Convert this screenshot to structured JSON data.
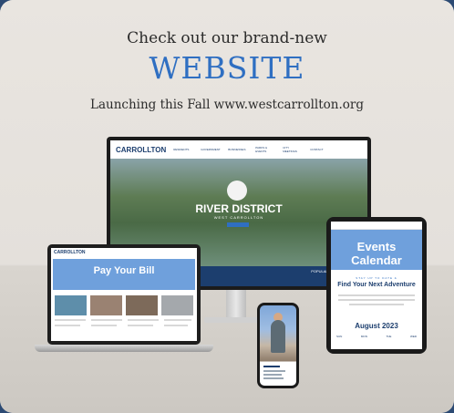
{
  "headline": "Check out our brand-new",
  "website_word": "WEBSITE",
  "launch_line": "Launching this Fall www.westcarrollton.org",
  "monitor": {
    "logo": "CARROLLTON",
    "nav_items": [
      "RESIDENTS",
      "GOVERNMENT",
      "BUSINESSES",
      "PARKS & EVENTS",
      "CITY MEETINGS",
      "CONTACT"
    ],
    "hero_title": "RIVER DISTRICT",
    "hero_subtitle": "WEST CARROLLTON",
    "footer_label": "POPULAR LINKS"
  },
  "laptop": {
    "logo": "CARROLLTON",
    "banner_title": "Pay Your Bill"
  },
  "tablet": {
    "banner_title": "Events Calendar",
    "kicker": "STAY UP TO DATE &",
    "find": "Find Your Next Adventure",
    "month": "August 2023",
    "days": [
      "SUN",
      "MON",
      "TUE",
      "WED"
    ]
  },
  "colors": {
    "accent_blue": "#2f6fc2",
    "navy": "#1c3e6e",
    "banner_blue": "#6fa0dc",
    "outer_frame": "#2c4a73"
  }
}
